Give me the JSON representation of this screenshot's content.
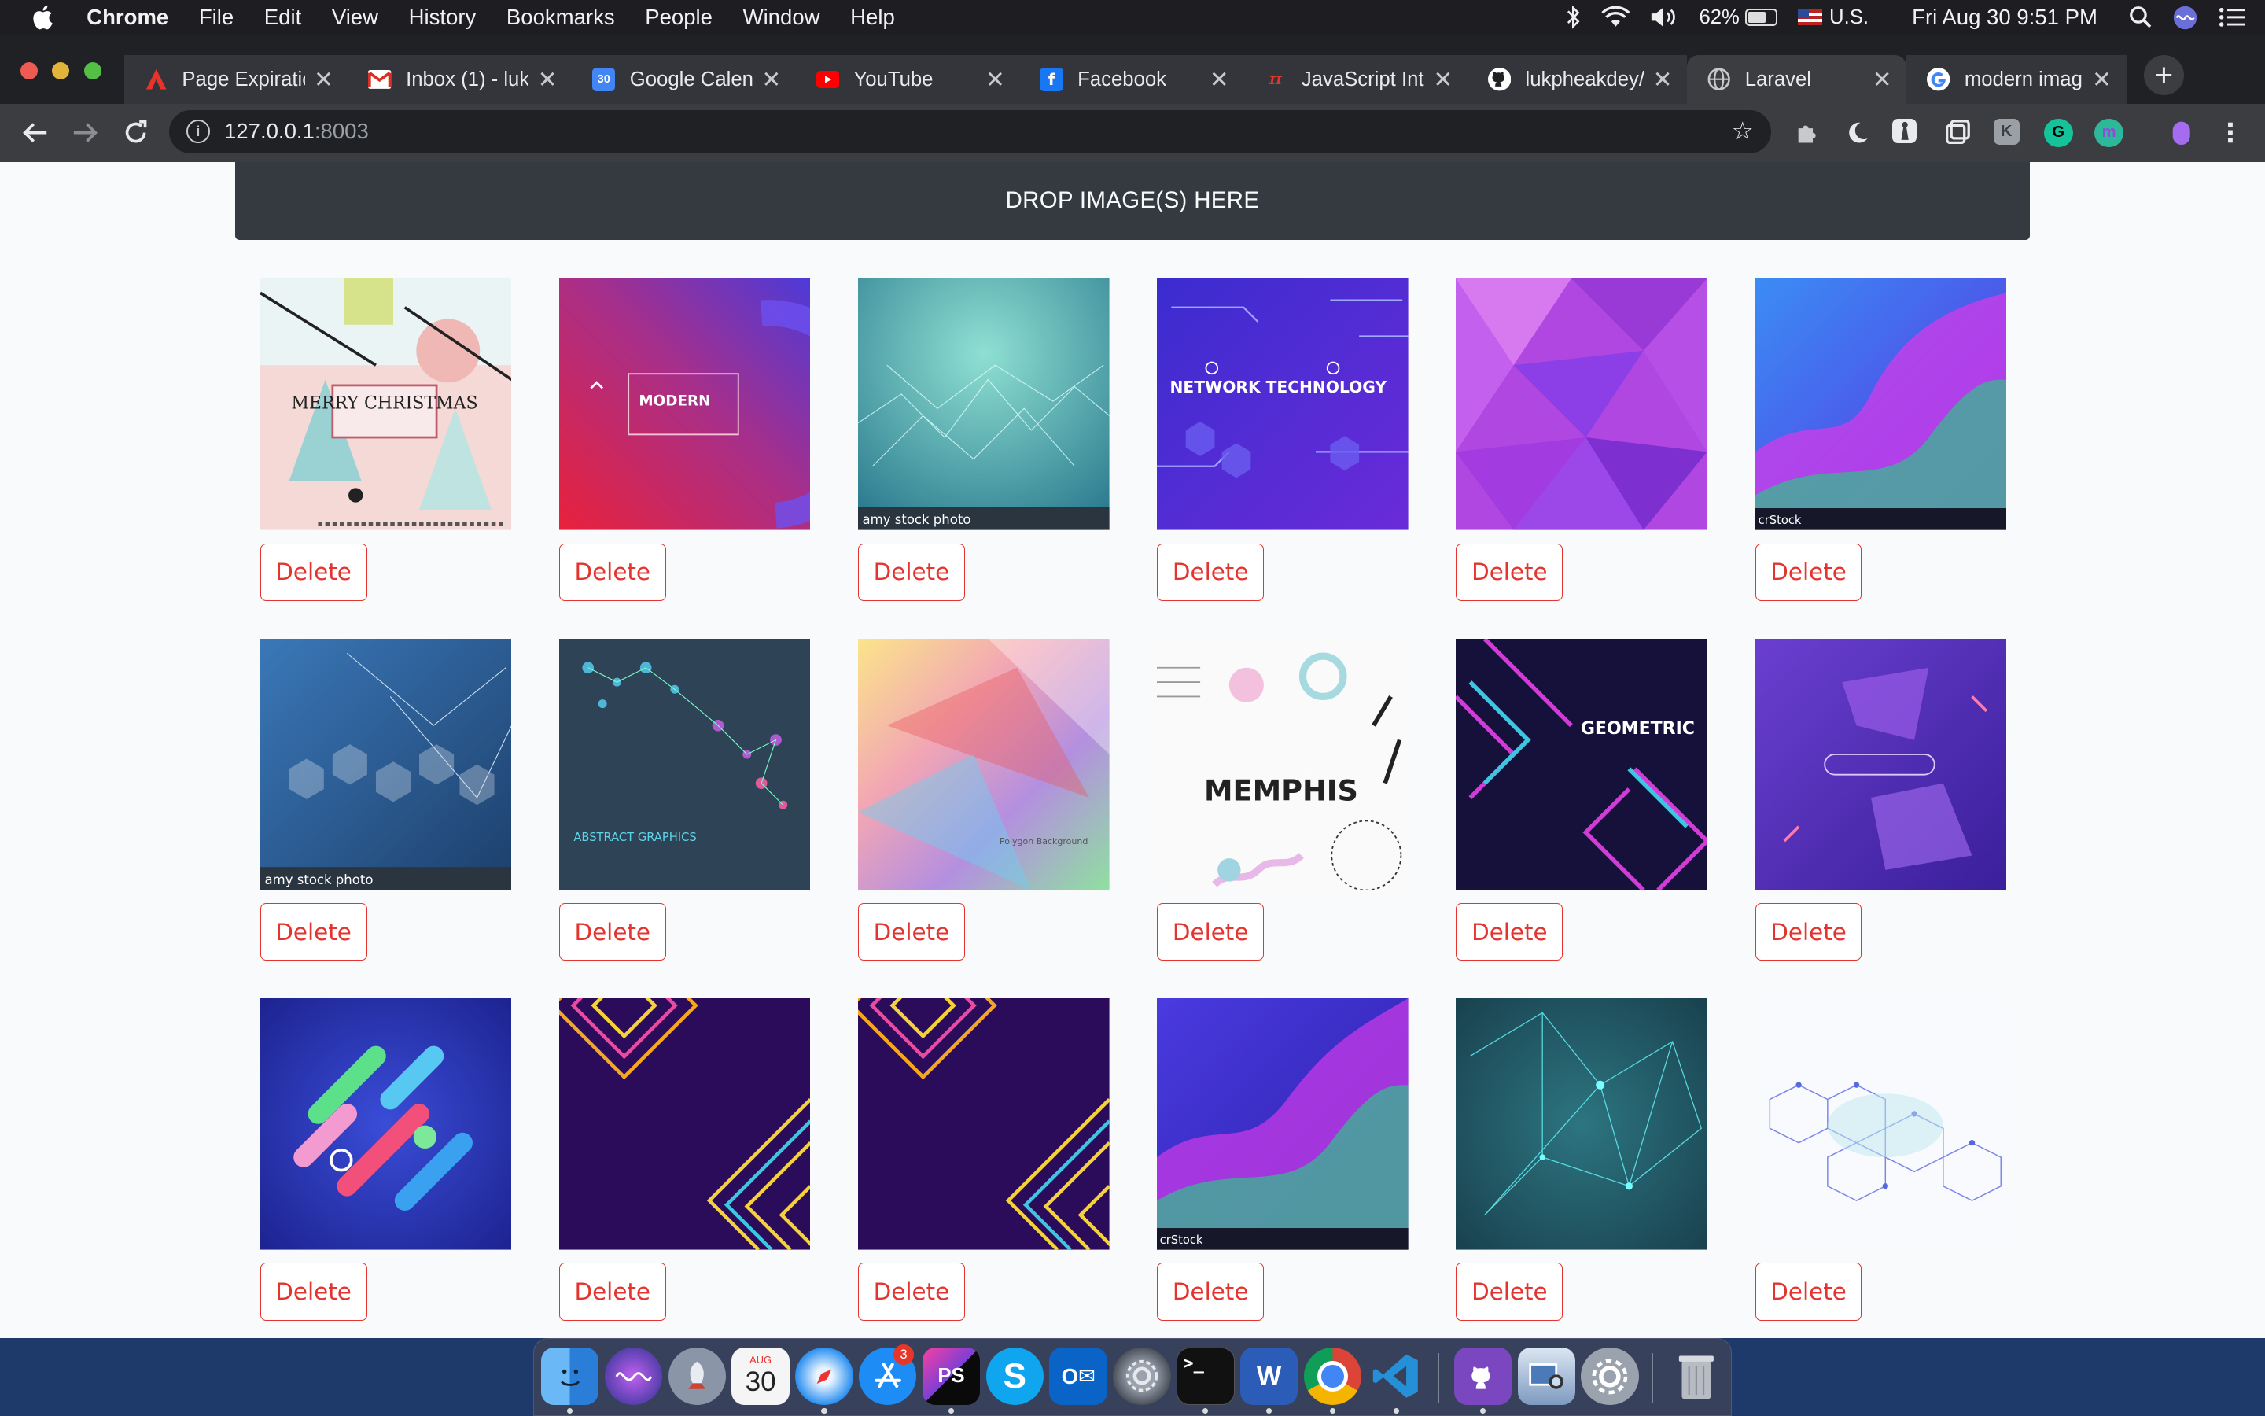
{
  "menubar": {
    "app": "Chrome",
    "items": [
      "File",
      "Edit",
      "View",
      "History",
      "Bookmarks",
      "People",
      "Window",
      "Help"
    ],
    "battery": "62%",
    "input_source": "U.S.",
    "clock": "Fri Aug 30  9:51 PM"
  },
  "tabs": [
    {
      "title": "Page Expiratio",
      "icon": "adobe-icon",
      "color": "#e8322a"
    },
    {
      "title": "Inbox (1) - luk",
      "icon": "gmail-icon",
      "color": "#d93025"
    },
    {
      "title": "Google Calen",
      "icon": "calendar-icon",
      "color": "#4285f4",
      "badge": "30"
    },
    {
      "title": "YouTube",
      "icon": "youtube-icon",
      "color": "#ff0000"
    },
    {
      "title": "Facebook",
      "icon": "facebook-icon",
      "color": "#1877f2"
    },
    {
      "title": "JavaScript Int",
      "icon": "javascript-info-icon",
      "color": "#e0362b"
    },
    {
      "title": "lukpheakdey/",
      "icon": "github-icon",
      "color": "#ffffff"
    },
    {
      "title": "Laravel",
      "icon": "globe-icon",
      "color": "#c7c9cc",
      "active": true
    },
    {
      "title": "modern imag",
      "icon": "google-icon",
      "color": "#4285f4"
    }
  ],
  "omnibox": {
    "host": "127.0.0.1",
    "port": ":8003"
  },
  "page": {
    "dropzone_label": "DROP IMAGE(S) HERE",
    "delete_label": "Delete",
    "images": [
      {
        "theme": "merry-christmas",
        "caption": "MERRY CHRISTMAS"
      },
      {
        "theme": "modern-colors",
        "caption": "MODERN"
      },
      {
        "theme": "teal-network",
        "caption": "amy stock photo"
      },
      {
        "theme": "network-technology",
        "caption": "NETWORK TECHNOLOGY"
      },
      {
        "theme": "purple-polygon",
        "caption": ""
      },
      {
        "theme": "fluid-purple",
        "caption": "crStock"
      },
      {
        "theme": "blue-hexagon",
        "caption": "amy stock photo"
      },
      {
        "theme": "abstract-graphics",
        "caption": "ABSTRACT GRAPHICS"
      },
      {
        "theme": "rainbow-polygon",
        "caption": "Polygon Background"
      },
      {
        "theme": "memphis",
        "caption": "MEMPHIS"
      },
      {
        "theme": "geometric-background",
        "caption": "GEOMETRIC"
      },
      {
        "theme": "purple-3d-shapes",
        "caption": ""
      },
      {
        "theme": "blue-pills",
        "caption": ""
      },
      {
        "theme": "neon-squares",
        "caption": ""
      },
      {
        "theme": "neon-squares",
        "caption": ""
      },
      {
        "theme": "fluid-purple",
        "caption": "crStock"
      },
      {
        "theme": "teal-plexus",
        "caption": ""
      },
      {
        "theme": "white-molecule",
        "caption": ""
      }
    ]
  },
  "dock": [
    {
      "name": "finder-icon",
      "color": "#3b8de6",
      "label": ""
    },
    {
      "name": "siri-icon",
      "color": "#3a3f8a",
      "label": ""
    },
    {
      "name": "launchpad-icon",
      "color": "#8a96a8",
      "label": ""
    },
    {
      "name": "calendar-icon",
      "color": "#f5f5f5",
      "label": "30"
    },
    {
      "name": "safari-icon",
      "color": "#2a8ff0",
      "label": ""
    },
    {
      "name": "app-store-icon",
      "color": "#1d8df5",
      "label": ""
    },
    {
      "name": "phpstorm-icon",
      "color": "#7b3fd6",
      "label": "PS"
    },
    {
      "name": "skype-icon",
      "color": "#0fa5ef",
      "label": "S"
    },
    {
      "name": "outlook-icon",
      "color": "#0a64c8",
      "label": "O"
    },
    {
      "name": "system-preferences-icon",
      "color": "#6e7480",
      "label": ""
    },
    {
      "name": "terminal-icon",
      "color": "#111111",
      "label": ">_"
    },
    {
      "name": "word-icon",
      "color": "#2b5cb8",
      "label": "W"
    },
    {
      "name": "chrome-icon",
      "color": "#ffffff",
      "label": ""
    },
    {
      "name": "vscode-icon",
      "color": "#2590d8",
      "label": ""
    },
    {
      "name": "github-desktop-icon",
      "color": "#7a47c0",
      "label": ""
    },
    {
      "name": "preview-icon",
      "color": "#8fa6c2",
      "label": ""
    },
    {
      "name": "settings-icon",
      "color": "#9aa2ae",
      "label": ""
    },
    {
      "name": "trash-icon",
      "color": "#8a8f98",
      "label": ""
    }
  ],
  "dock_badge": "3"
}
